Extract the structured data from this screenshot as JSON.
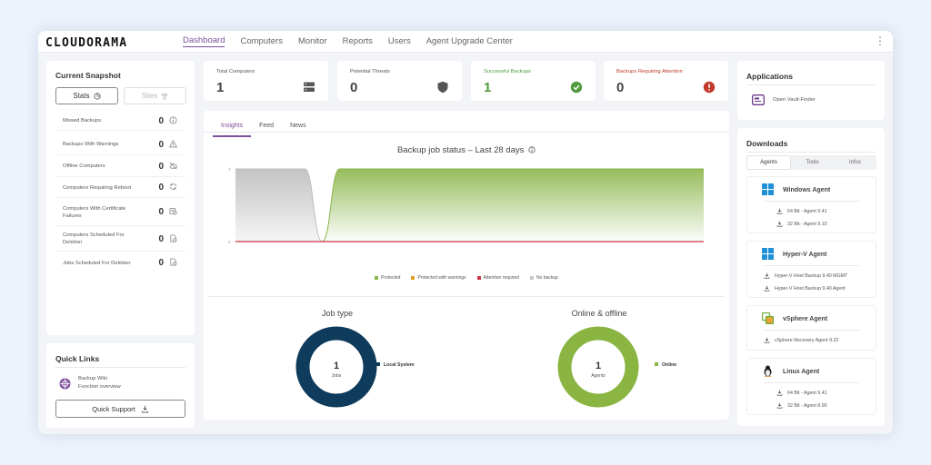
{
  "app": {
    "logo": "CLOUDORAMA"
  },
  "nav": {
    "items": [
      "Dashboard",
      "Computers",
      "Monitor",
      "Reports",
      "Users",
      "Agent Upgrade Center"
    ],
    "active": 0
  },
  "snapshot": {
    "title": "Current Snapshot",
    "stats_btn": "Stats",
    "sites_btn": "Sites",
    "rows": [
      {
        "label": "Missed Backups",
        "value": "0",
        "icon": "info-icon"
      },
      {
        "label": "Backups With Warnings",
        "value": "0",
        "icon": "warning-icon"
      },
      {
        "label": "Offline Computers",
        "value": "0",
        "icon": "cloud-off-icon"
      },
      {
        "label": "Computers Requiring Reboot",
        "value": "0",
        "icon": "reboot-icon"
      },
      {
        "label": "Computers With Certificate Failures",
        "value": "0",
        "icon": "certificate-icon"
      },
      {
        "label": "Computers Scheduled For Deletion",
        "value": "0",
        "icon": "delete-schedule-icon"
      },
      {
        "label": "Jobs Scheduled For Deletion",
        "value": "0",
        "icon": "delete-schedule-icon"
      }
    ]
  },
  "quick_links": {
    "title": "Quick Links",
    "wiki_title": "Backup Wiki",
    "wiki_sub": "Function overview",
    "support_btn": "Quick Support"
  },
  "stats": [
    {
      "label": "Total Computers",
      "value": "1",
      "icon": "server-icon",
      "color": "#555555"
    },
    {
      "label": "Potential Threats",
      "value": "0",
      "icon": "shield-icon",
      "color": "#555555"
    },
    {
      "label": "Successful Backups",
      "value": "1",
      "icon": "check-circle-icon",
      "color": "#4e9a3c"
    },
    {
      "label": "Backups Requiring Attention",
      "value": "0",
      "icon": "alert-circle-icon",
      "color": "#c0392b"
    }
  ],
  "main": {
    "tabs": [
      "Insights",
      "Feed",
      "News"
    ],
    "active_tab": 0,
    "chart_title": "Backup job status – Last 28 days",
    "job_type_title": "Job type",
    "online_title": "Online & offline",
    "jobs_value": "1",
    "jobs_label": "Jobs",
    "agents_value": "1",
    "agents_label": "Agents"
  },
  "colors": {
    "accent": "#7b4f9a",
    "protected": "#8ab54a",
    "warnings": "#e0a020",
    "attention": "#cc3344",
    "nobackup": "#c8c8c8",
    "local": "#0f3b5c",
    "online": "#8ab542"
  },
  "chart_data": [
    {
      "type": "area",
      "title": "Backup job status – Last 28 days",
      "ylim": [
        0,
        1
      ],
      "yticks": [
        "1",
        "0"
      ],
      "x": [
        1,
        2,
        3,
        4,
        5,
        6,
        7,
        8,
        9,
        10,
        11,
        12,
        13,
        14,
        15,
        16,
        17,
        18,
        19,
        20,
        21,
        22,
        23,
        24,
        25,
        26,
        27,
        28
      ],
      "series": [
        {
          "name": "Protected",
          "values": [
            0,
            0,
            0,
            0,
            0,
            0,
            1,
            1,
            1,
            1,
            1,
            1,
            1,
            1,
            1,
            1,
            1,
            1,
            1,
            1,
            1,
            1,
            1,
            1,
            1,
            1,
            1,
            1
          ]
        },
        {
          "name": "Protected with warnings",
          "values": [
            0,
            0,
            0,
            0,
            0,
            0,
            0,
            0,
            0,
            0,
            0,
            0,
            0,
            0,
            0,
            0,
            0,
            0,
            0,
            0,
            0,
            0,
            0,
            0,
            0,
            0,
            0,
            0
          ]
        },
        {
          "name": "Attention required",
          "values": [
            0,
            0,
            0,
            0,
            0,
            0,
            0,
            0,
            0,
            0,
            0,
            0,
            0,
            0,
            0,
            0,
            0,
            0,
            0,
            0,
            0,
            0,
            0,
            0,
            0,
            0,
            0,
            0
          ]
        },
        {
          "name": "No backup",
          "values": [
            1,
            1,
            1,
            1,
            1,
            0,
            0,
            0,
            0,
            0,
            0,
            0,
            0,
            0,
            0,
            0,
            0,
            0,
            0,
            0,
            0,
            0,
            0,
            0,
            0,
            0,
            0,
            0
          ]
        }
      ],
      "legend": "bottom"
    },
    {
      "type": "pie",
      "title": "Job type",
      "categories": [
        "Local System"
      ],
      "values": [
        1
      ],
      "legend": "right"
    },
    {
      "type": "pie",
      "title": "Online & offline",
      "categories": [
        "Online"
      ],
      "values": [
        1
      ],
      "legend": "right"
    }
  ],
  "applications": {
    "title": "Applications",
    "vault": "Open Vault-Finder"
  },
  "downloads": {
    "title": "Downloads",
    "tabs": [
      "Agents",
      "Tools",
      "Infos"
    ],
    "active_tab": 0,
    "agents": [
      {
        "name": "Windows Agent",
        "icon": "windows-icon",
        "links": [
          "64 Bit - Agent 9.41",
          "32 Bit - Agent 9.10"
        ]
      },
      {
        "name": "Hyper-V Agent",
        "icon": "windows-icon",
        "links": [
          "Hyper-V Host Backup 9.40 MGMT",
          "Hyper-V Host Backup 9.40 Agent"
        ]
      },
      {
        "name": "vSphere Agent",
        "icon": "vsphere-icon",
        "links": [
          "vSphere Recovery Agent 9.22"
        ]
      },
      {
        "name": "Linux Agent",
        "icon": "linux-icon",
        "links": [
          "64 Bit - Agent 9.41",
          "32 Bit - Agent 8.90"
        ]
      }
    ]
  }
}
